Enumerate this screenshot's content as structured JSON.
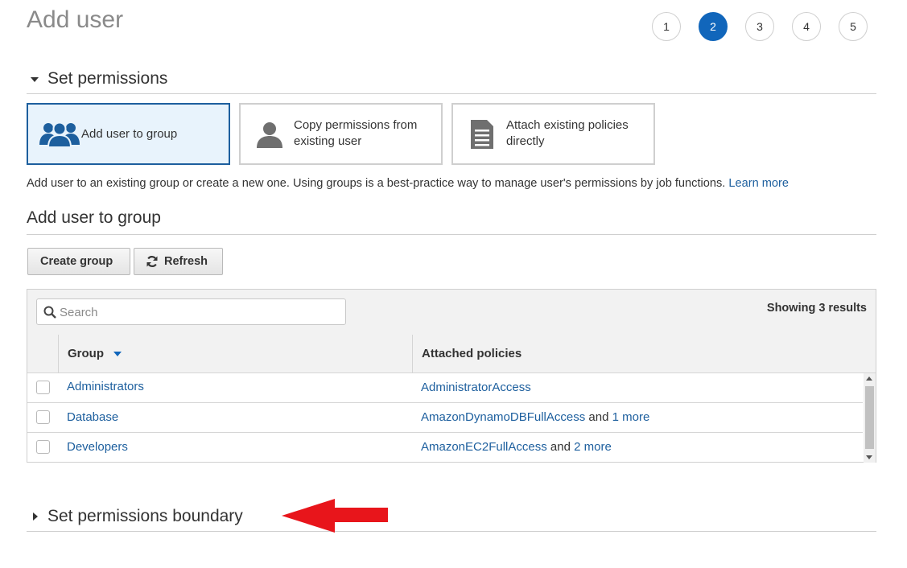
{
  "page": {
    "title": "Add user"
  },
  "wizard": {
    "steps": [
      "1",
      "2",
      "3",
      "4",
      "5"
    ],
    "active_step": "2"
  },
  "set_permissions": {
    "heading": "Set permissions",
    "options": [
      {
        "label": "Add user to group",
        "icon": "users-group-icon",
        "selected": true
      },
      {
        "label_line1": "Copy permissions from",
        "label_line2": "existing user",
        "icon": "user-icon",
        "selected": false
      },
      {
        "label_line1": "Attach existing policies",
        "label_line2": "directly",
        "icon": "document-icon",
        "selected": false
      }
    ],
    "description": "Add user to an existing group or create a new one. Using groups is a best-practice way to manage user's permissions by job functions.",
    "learn_more": "Learn more"
  },
  "add_to_group": {
    "heading": "Add user to group",
    "create_group_label": "Create group",
    "refresh_label": "Refresh",
    "search_placeholder": "Search",
    "results_text": "Showing 3 results",
    "columns": {
      "group": "Group",
      "policies": "Attached policies"
    },
    "rows": [
      {
        "group": "Administrators",
        "policy": "AdministratorAccess",
        "and_text": "",
        "more": ""
      },
      {
        "group": "Database",
        "policy": "AmazonDynamoDBFullAccess",
        "and_text": "and",
        "more": "1 more"
      },
      {
        "group": "Developers",
        "policy": "AmazonEC2FullAccess",
        "and_text": "and",
        "more": "2 more"
      }
    ]
  },
  "boundary": {
    "heading": "Set permissions boundary"
  },
  "colors": {
    "accent": "#1166bb",
    "link": "#1d5f9e",
    "selected_bg": "#e8f3fc",
    "annotation_arrow": "#e8151b"
  }
}
